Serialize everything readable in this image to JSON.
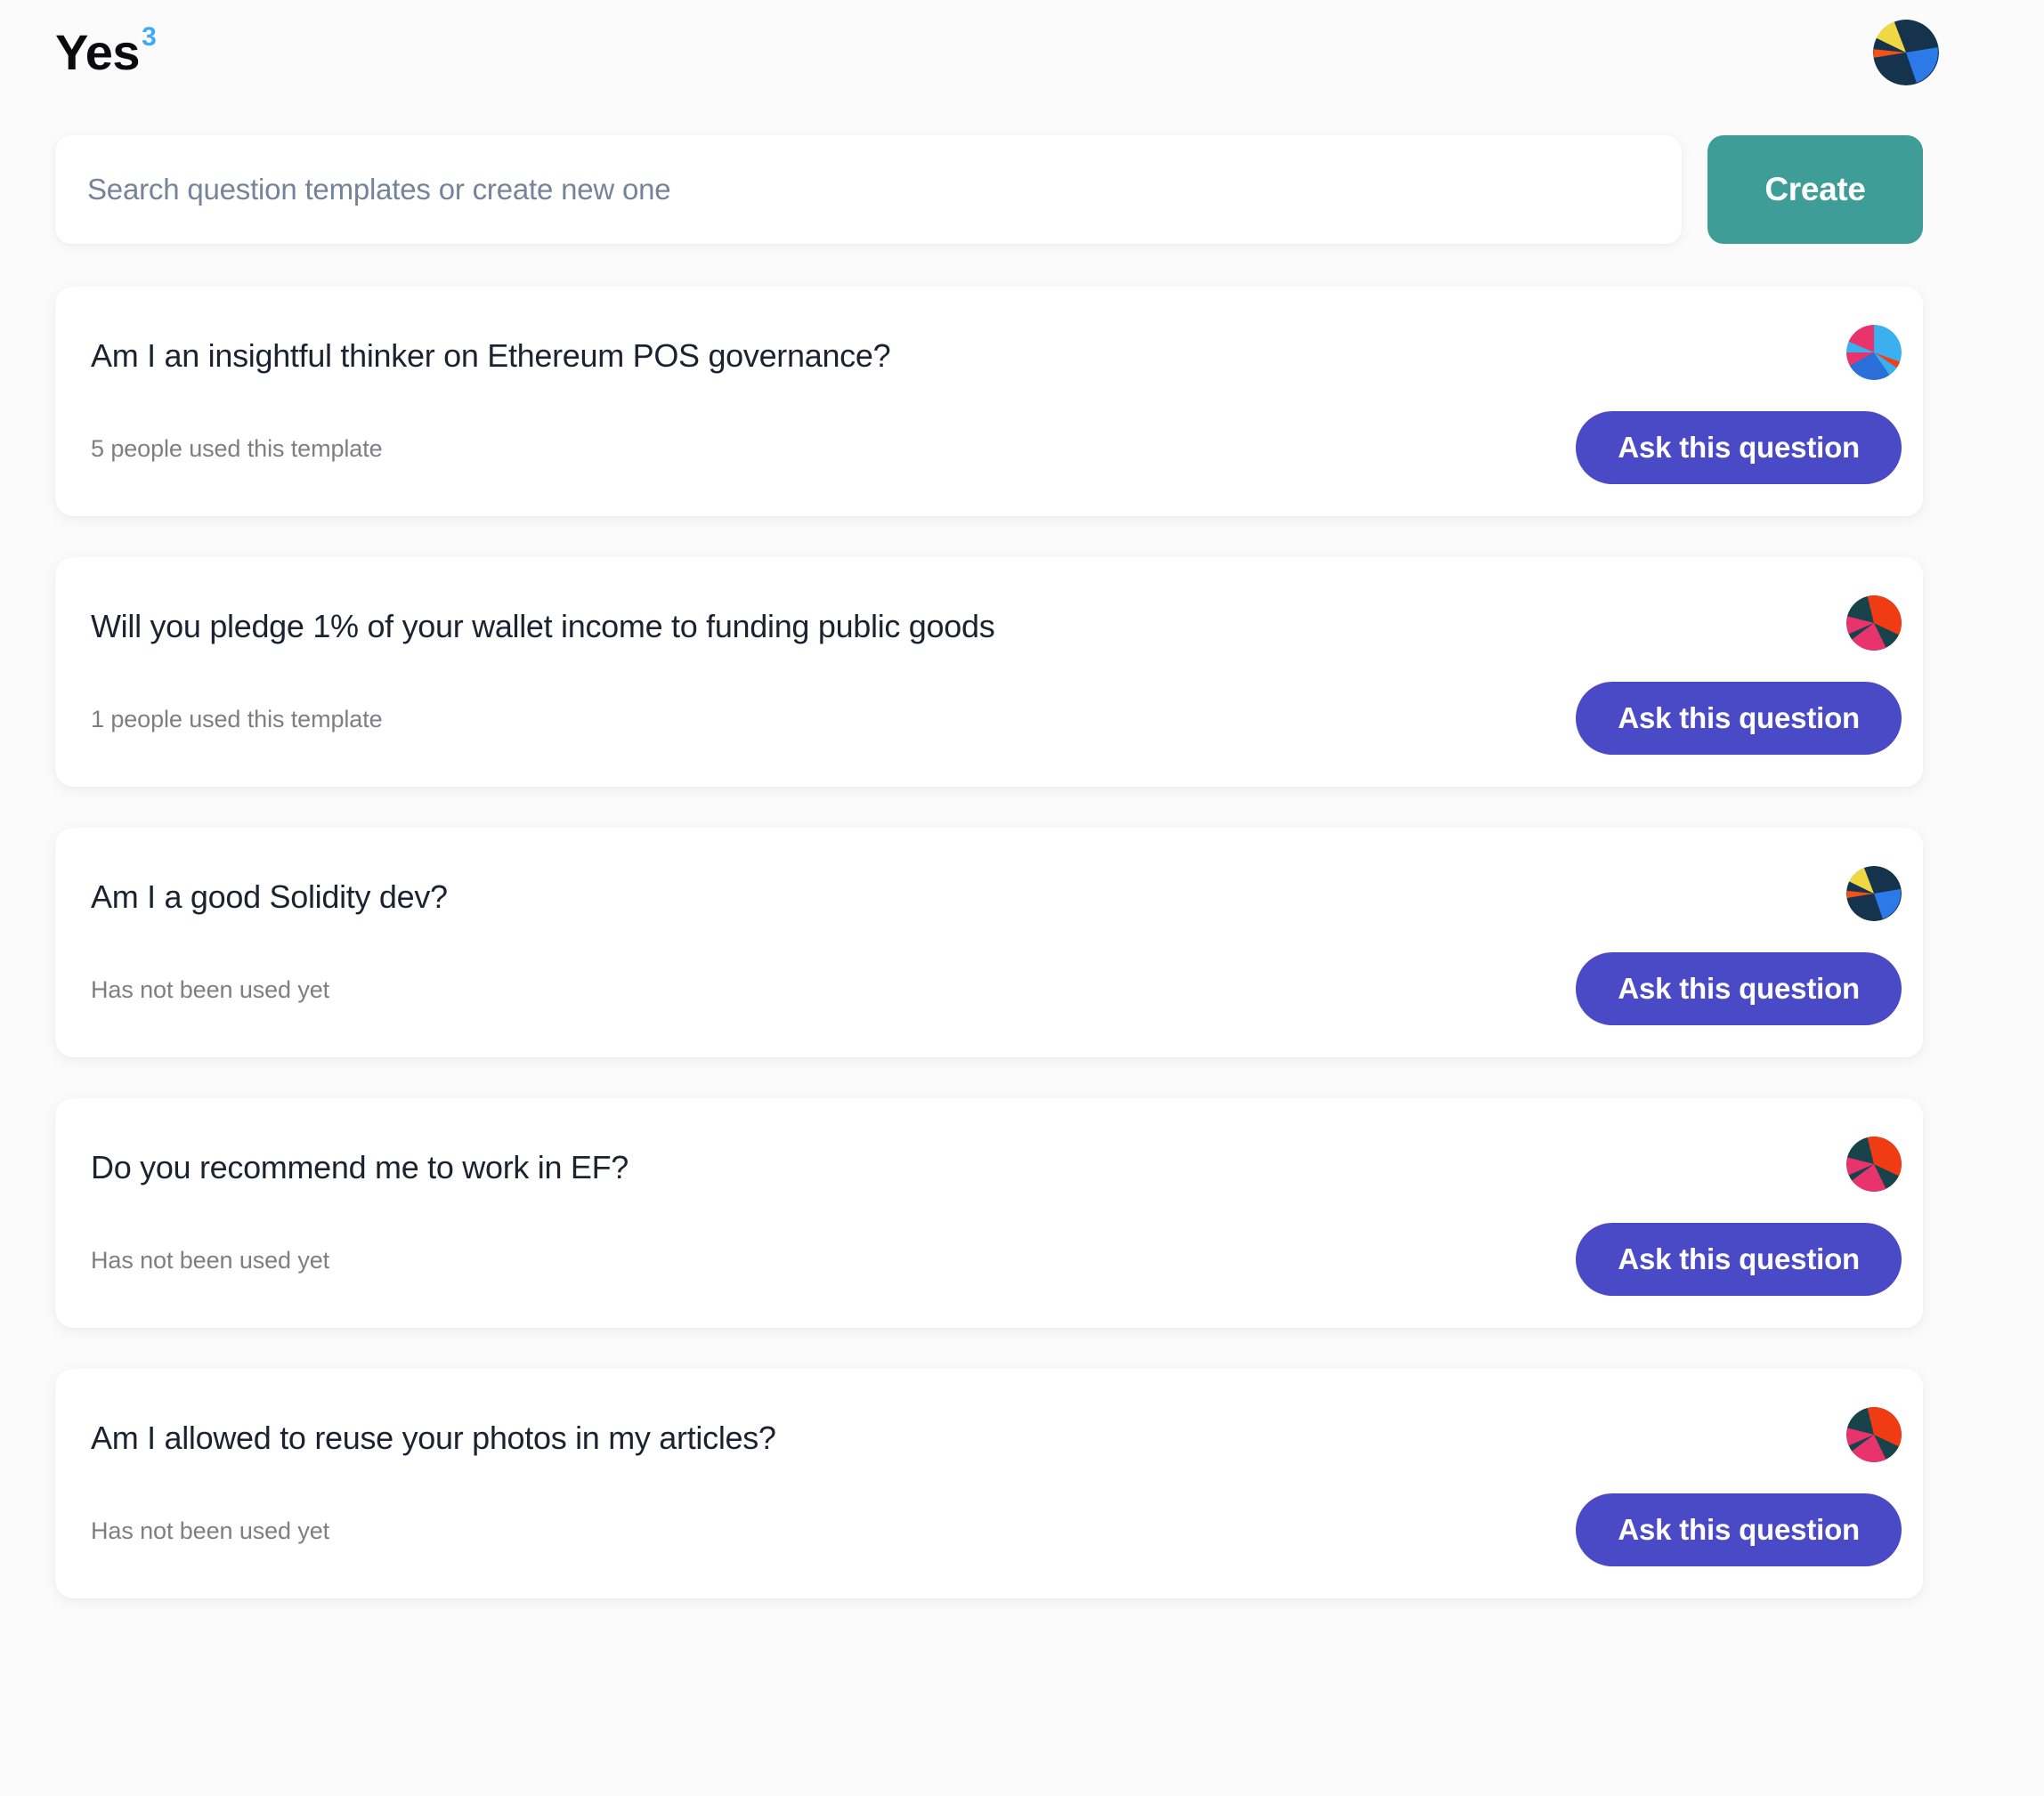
{
  "header": {
    "logo_text": "Yes",
    "logo_superscript": "3",
    "logo_color": "#0b0b0f",
    "logo_superscript_color": "#3fa9f5",
    "avatar_icon": "pie-identicon-avatar"
  },
  "search": {
    "value": "",
    "placeholder": "Search question templates or create new one",
    "create_label": "Create",
    "create_color": "#3e9e97"
  },
  "theme": {
    "page_background": "#fbfbfb",
    "card_background": "#ffffff",
    "ask_button_color": "#4a4ac7",
    "title_color": "#1c2330",
    "meta_color": "#7e7e84"
  },
  "templates": [
    {
      "title": "Am I an insightful thinker on Ethereum POS governance?",
      "usage": "5 people used this template",
      "action_label": "Ask this question",
      "icon": "pie-identicon-pink-blue",
      "icon_colors": [
        "#e8336d",
        "#3bb0ee",
        "#2b6fd8",
        "#f0401a"
      ]
    },
    {
      "title": "Will you pledge 1% of your wallet income to funding public goods",
      "usage": "1 people used this template",
      "action_label": "Ask this question",
      "icon": "pie-identicon-teal-red",
      "icon_colors": [
        "#17434a",
        "#ef3c13",
        "#e8336d"
      ]
    },
    {
      "title": "Am I a good Solidity dev?",
      "usage": "Has not been used yet",
      "action_label": "Ask this question",
      "icon": "pie-identicon-navy-yellow",
      "icon_colors": [
        "#15334d",
        "#efd843",
        "#2b7ae8",
        "#f2521a"
      ]
    },
    {
      "title": "Do you recommend me to work in EF?",
      "usage": "Has not been used yet",
      "action_label": "Ask this question",
      "icon": "pie-identicon-teal-red",
      "icon_colors": [
        "#17434a",
        "#ef3c13",
        "#e8336d"
      ]
    },
    {
      "title": "Am I allowed to reuse your photos in my articles?",
      "usage": "Has not been used yet",
      "action_label": "Ask this question",
      "icon": "pie-identicon-teal-red",
      "icon_colors": [
        "#17434a",
        "#ef3c13",
        "#e8336d"
      ]
    }
  ]
}
